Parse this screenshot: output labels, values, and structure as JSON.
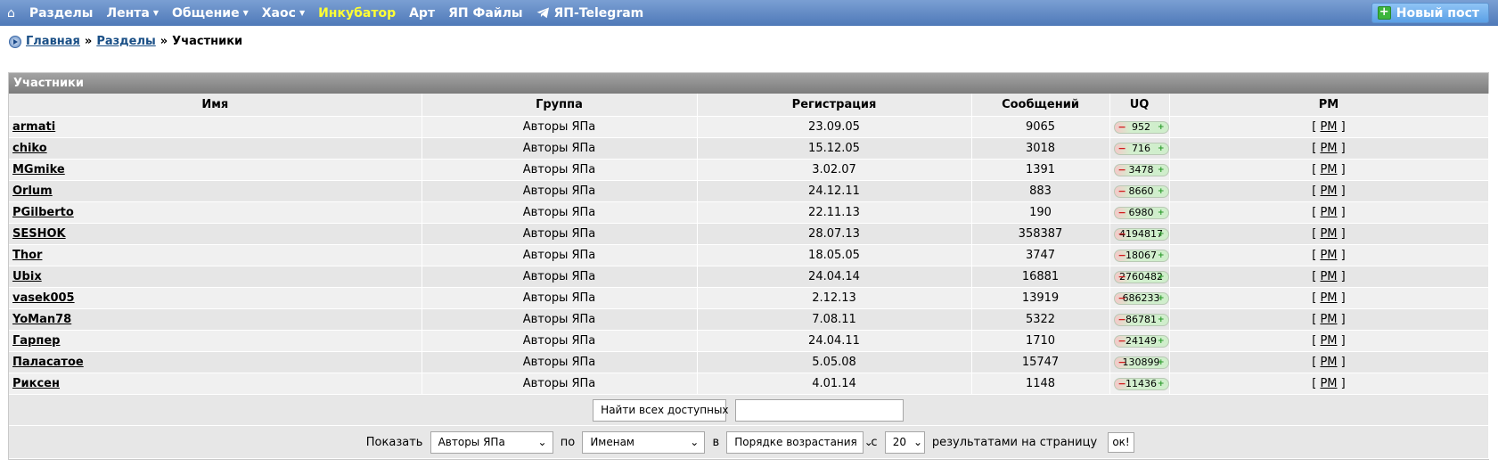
{
  "nav": {
    "items": [
      {
        "label": "Разделы",
        "caret": false,
        "highlight": false
      },
      {
        "label": "Лента",
        "caret": true,
        "highlight": false
      },
      {
        "label": "Общение",
        "caret": true,
        "highlight": false
      },
      {
        "label": "Хаос",
        "caret": true,
        "highlight": false
      },
      {
        "label": "Инкубатор",
        "caret": false,
        "highlight": true
      },
      {
        "label": "Арт",
        "caret": false,
        "highlight": false
      },
      {
        "label": "ЯП Файлы",
        "caret": false,
        "highlight": false
      }
    ],
    "telegram_label": "ЯП-Telegram",
    "new_post_label": "Новый пост"
  },
  "breadcrumb": {
    "home": "Главная",
    "sections": "Разделы",
    "current": "Участники",
    "separator": "»"
  },
  "panel": {
    "title": "Участники"
  },
  "table": {
    "columns": {
      "name": "Имя",
      "group": "Группа",
      "registered": "Регистрация",
      "posts": "Сообщений",
      "uq": "UQ",
      "pm": "PM"
    },
    "rows": [
      {
        "name": "armati",
        "group": "Авторы ЯПа",
        "registered": "23.09.05",
        "posts": "9065",
        "uq": "952"
      },
      {
        "name": "chiko",
        "group": "Авторы ЯПа",
        "registered": "15.12.05",
        "posts": "3018",
        "uq": "716"
      },
      {
        "name": "MGmike",
        "group": "Авторы ЯПа",
        "registered": "3.02.07",
        "posts": "1391",
        "uq": "3478"
      },
      {
        "name": "Orlum",
        "group": "Авторы ЯПа",
        "registered": "24.12.11",
        "posts": "883",
        "uq": "8660"
      },
      {
        "name": "PGilberto",
        "group": "Авторы ЯПа",
        "registered": "22.11.13",
        "posts": "190",
        "uq": "6980"
      },
      {
        "name": "SESHOK",
        "group": "Авторы ЯПа",
        "registered": "28.07.13",
        "posts": "358387",
        "uq": "4194817"
      },
      {
        "name": "Thor",
        "group": "Авторы ЯПа",
        "registered": "18.05.05",
        "posts": "3747",
        "uq": "18067"
      },
      {
        "name": "Ubix",
        "group": "Авторы ЯПа",
        "registered": "24.04.14",
        "posts": "16881",
        "uq": "2760482"
      },
      {
        "name": "vasek005",
        "group": "Авторы ЯПа",
        "registered": "2.12.13",
        "posts": "13919",
        "uq": "686233"
      },
      {
        "name": "YoMan78",
        "group": "Авторы ЯПа",
        "registered": "7.08.11",
        "posts": "5322",
        "uq": "86781"
      },
      {
        "name": "Гарпер",
        "group": "Авторы ЯПа",
        "registered": "24.04.11",
        "posts": "1710",
        "uq": "24149"
      },
      {
        "name": "Паласатое",
        "group": "Авторы ЯПа",
        "registered": "5.05.08",
        "posts": "15747",
        "uq": "130899"
      },
      {
        "name": "Риксен",
        "group": "Авторы ЯПа",
        "registered": "4.01.14",
        "posts": "1148",
        "uq": "11436"
      }
    ],
    "pm_label": "PM",
    "pm_open": "[",
    "pm_close": "]",
    "uq_minus": "−",
    "uq_plus": "+"
  },
  "search": {
    "scope_value": "Найти всех доступных",
    "query_value": ""
  },
  "filter": {
    "show_label": "Показать",
    "group_value": "Авторы ЯПа",
    "by_label": "по",
    "sort_value": "Именам",
    "in_label": "в",
    "order_value": "Порядке возрастания",
    "from_label": "с",
    "per_page_value": "20",
    "per_page_label": "результатами на страницу",
    "ok_label": "ок!"
  },
  "colors": {
    "nav_bg": "#5b83bf",
    "highlight": "#ffff33",
    "link": "#1a4f86",
    "panel_head": "#8c8c8c"
  }
}
